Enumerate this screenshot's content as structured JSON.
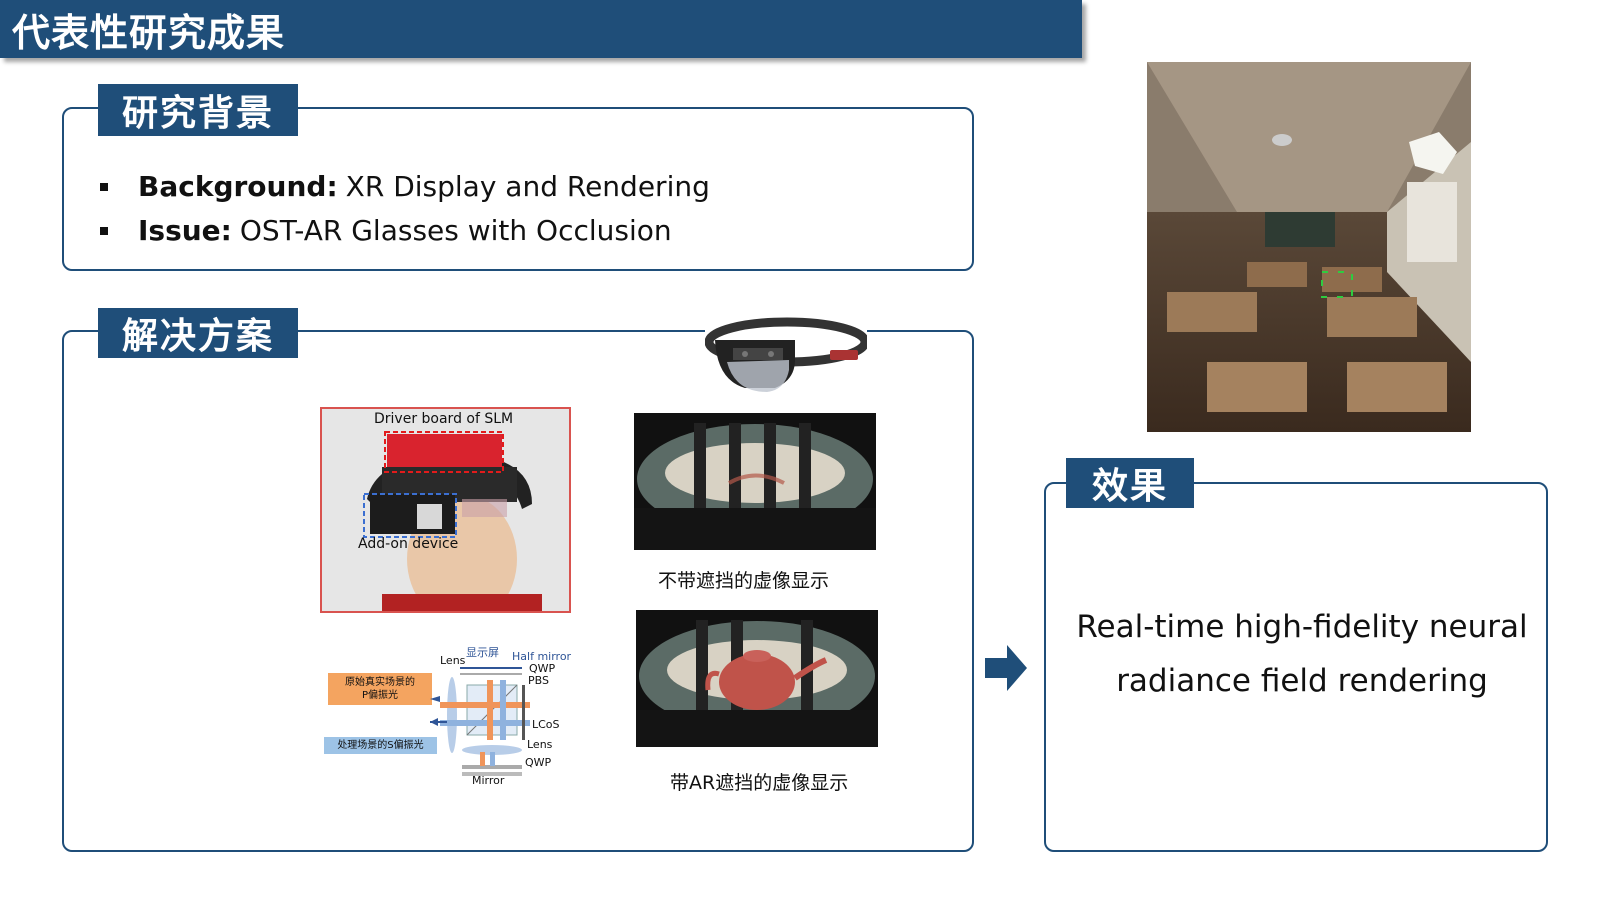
{
  "header": {
    "title": "代表性研究成果"
  },
  "background_panel": {
    "tag": "研究背景",
    "items": [
      {
        "label": "Background:",
        "text": "XR Display and Rendering"
      },
      {
        "label": "Issue:",
        "text": "OST-AR Glasses with Occlusion"
      }
    ]
  },
  "solution_panel": {
    "tag": "解决方案",
    "prototype": {
      "driver_label": "Driver board of SLM",
      "addon_label": "Add-on device"
    },
    "diagram": {
      "display_label": "显示屏",
      "half_mirror": "Half mirror",
      "lens_top": "Lens",
      "qwp_top": "QWP",
      "pbs": "PBS",
      "lcos": "LCoS",
      "lens_bottom": "Lens",
      "qwp_bottom": "QWP",
      "mirror": "Mirror",
      "orange_box": "原始真实场景的\nP偏振光",
      "blue_box": "处理场景的S偏振光"
    },
    "caption_no_occlusion": "不带遮挡的虚像显示",
    "caption_with_occlusion": "带AR遮挡的虚像显示"
  },
  "result_panel": {
    "tag": "效果",
    "text_line1": "Real-time high-fidelity neural",
    "text_line2": "radiance field rendering"
  },
  "colors": {
    "accent": "#1f4e79",
    "orange": "#f4a460",
    "blue_box": "#9dc3e6",
    "red_frame": "#d9534f"
  }
}
